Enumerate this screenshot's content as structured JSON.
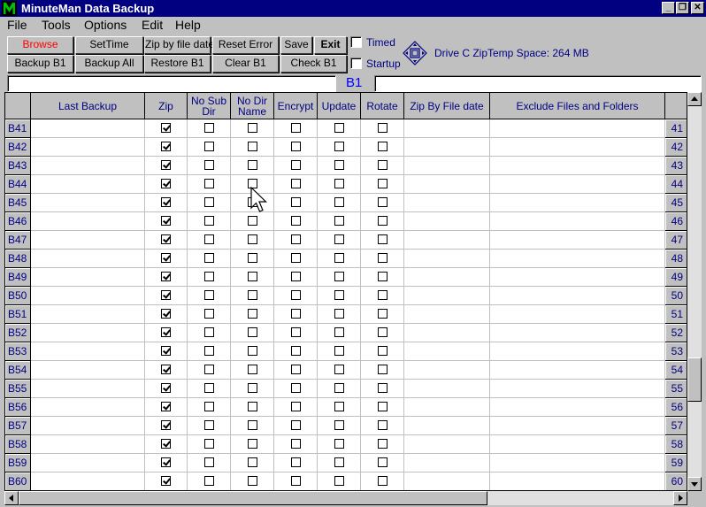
{
  "app": {
    "title": "MinuteMan Data Backup",
    "logo_letter": "M"
  },
  "window_controls": {
    "minimize": "_",
    "restore": "❐",
    "close": "✕"
  },
  "menu": [
    {
      "label": "File",
      "accel": "F"
    },
    {
      "label": "Tools",
      "accel": "T"
    },
    {
      "label": "Options",
      "accel": "O"
    },
    {
      "label": "Edit",
      "accel": "E"
    },
    {
      "label": "Help",
      "accel": "H"
    }
  ],
  "toolbar": {
    "browse": "Browse",
    "set_time": "SetTime",
    "zip_by_file_date": "Zip by file date",
    "reset_error": "Reset Error",
    "save": "Save",
    "exit": "Exit",
    "backup_b1": "Backup B1",
    "backup_all": "Backup All",
    "restore_b1": "Restore B1",
    "clear_b1": "Clear B1",
    "check_b1": "Check B1",
    "timed_label": "Timed",
    "startup_label": "Startup",
    "timed_checked": false,
    "startup_checked": false,
    "drive_info": "Drive C ZipTemp Space: 264 MB"
  },
  "selection": {
    "left_field": "",
    "label": "B1",
    "right_field": ""
  },
  "grid": {
    "columns": [
      "Last Backup",
      "Zip",
      "No Sub Dir",
      "No Dir Name",
      "Encrypt",
      "Update",
      "Rotate",
      "Zip By File date",
      "Exclude Files and Folders"
    ],
    "rows": [
      {
        "id": "B41",
        "num": "41",
        "last_backup": "",
        "zip": true,
        "no_sub_dir": false,
        "no_dir_name": false,
        "encrypt": false,
        "update": false,
        "rotate": false,
        "zip_by_file_date": "",
        "exclude": ""
      },
      {
        "id": "B42",
        "num": "42",
        "last_backup": "",
        "zip": true,
        "no_sub_dir": false,
        "no_dir_name": false,
        "encrypt": false,
        "update": false,
        "rotate": false,
        "zip_by_file_date": "",
        "exclude": ""
      },
      {
        "id": "B43",
        "num": "43",
        "last_backup": "",
        "zip": true,
        "no_sub_dir": false,
        "no_dir_name": false,
        "encrypt": false,
        "update": false,
        "rotate": false,
        "zip_by_file_date": "",
        "exclude": ""
      },
      {
        "id": "B44",
        "num": "44",
        "last_backup": "",
        "zip": true,
        "no_sub_dir": false,
        "no_dir_name": false,
        "encrypt": false,
        "update": false,
        "rotate": false,
        "zip_by_file_date": "",
        "exclude": ""
      },
      {
        "id": "B45",
        "num": "45",
        "last_backup": "",
        "zip": true,
        "no_sub_dir": false,
        "no_dir_name": false,
        "encrypt": false,
        "update": false,
        "rotate": false,
        "zip_by_file_date": "",
        "exclude": ""
      },
      {
        "id": "B46",
        "num": "46",
        "last_backup": "",
        "zip": true,
        "no_sub_dir": false,
        "no_dir_name": false,
        "encrypt": false,
        "update": false,
        "rotate": false,
        "zip_by_file_date": "",
        "exclude": ""
      },
      {
        "id": "B47",
        "num": "47",
        "last_backup": "",
        "zip": true,
        "no_sub_dir": false,
        "no_dir_name": false,
        "encrypt": false,
        "update": false,
        "rotate": false,
        "zip_by_file_date": "",
        "exclude": ""
      },
      {
        "id": "B48",
        "num": "48",
        "last_backup": "",
        "zip": true,
        "no_sub_dir": false,
        "no_dir_name": false,
        "encrypt": false,
        "update": false,
        "rotate": false,
        "zip_by_file_date": "",
        "exclude": ""
      },
      {
        "id": "B49",
        "num": "49",
        "last_backup": "",
        "zip": true,
        "no_sub_dir": false,
        "no_dir_name": false,
        "encrypt": false,
        "update": false,
        "rotate": false,
        "zip_by_file_date": "",
        "exclude": ""
      },
      {
        "id": "B50",
        "num": "50",
        "last_backup": "",
        "zip": true,
        "no_sub_dir": false,
        "no_dir_name": false,
        "encrypt": false,
        "update": false,
        "rotate": false,
        "zip_by_file_date": "",
        "exclude": ""
      },
      {
        "id": "B51",
        "num": "51",
        "last_backup": "",
        "zip": true,
        "no_sub_dir": false,
        "no_dir_name": false,
        "encrypt": false,
        "update": false,
        "rotate": false,
        "zip_by_file_date": "",
        "exclude": ""
      },
      {
        "id": "B52",
        "num": "52",
        "last_backup": "",
        "zip": true,
        "no_sub_dir": false,
        "no_dir_name": false,
        "encrypt": false,
        "update": false,
        "rotate": false,
        "zip_by_file_date": "",
        "exclude": ""
      },
      {
        "id": "B53",
        "num": "53",
        "last_backup": "",
        "zip": true,
        "no_sub_dir": false,
        "no_dir_name": false,
        "encrypt": false,
        "update": false,
        "rotate": false,
        "zip_by_file_date": "",
        "exclude": ""
      },
      {
        "id": "B54",
        "num": "54",
        "last_backup": "",
        "zip": true,
        "no_sub_dir": false,
        "no_dir_name": false,
        "encrypt": false,
        "update": false,
        "rotate": false,
        "zip_by_file_date": "",
        "exclude": ""
      },
      {
        "id": "B55",
        "num": "55",
        "last_backup": "",
        "zip": true,
        "no_sub_dir": false,
        "no_dir_name": false,
        "encrypt": false,
        "update": false,
        "rotate": false,
        "zip_by_file_date": "",
        "exclude": ""
      },
      {
        "id": "B56",
        "num": "56",
        "last_backup": "",
        "zip": true,
        "no_sub_dir": false,
        "no_dir_name": false,
        "encrypt": false,
        "update": false,
        "rotate": false,
        "zip_by_file_date": "",
        "exclude": ""
      },
      {
        "id": "B57",
        "num": "57",
        "last_backup": "",
        "zip": true,
        "no_sub_dir": false,
        "no_dir_name": false,
        "encrypt": false,
        "update": false,
        "rotate": false,
        "zip_by_file_date": "",
        "exclude": ""
      },
      {
        "id": "B58",
        "num": "58",
        "last_backup": "",
        "zip": true,
        "no_sub_dir": false,
        "no_dir_name": false,
        "encrypt": false,
        "update": false,
        "rotate": false,
        "zip_by_file_date": "",
        "exclude": ""
      },
      {
        "id": "B59",
        "num": "59",
        "last_backup": "",
        "zip": true,
        "no_sub_dir": false,
        "no_dir_name": false,
        "encrypt": false,
        "update": false,
        "rotate": false,
        "zip_by_file_date": "",
        "exclude": ""
      },
      {
        "id": "B60",
        "num": "60",
        "last_backup": "",
        "zip": true,
        "no_sub_dir": false,
        "no_dir_name": false,
        "encrypt": false,
        "update": false,
        "rotate": false,
        "zip_by_file_date": "",
        "exclude": ""
      }
    ]
  },
  "colors": {
    "titlebar": "#000080",
    "browse_text": "#ff0000",
    "header_text": "#000080",
    "selection_label": "#0000ff",
    "logo": "#00c000"
  },
  "icons": [
    "drive-icon",
    "mouse-cursor-icon"
  ]
}
